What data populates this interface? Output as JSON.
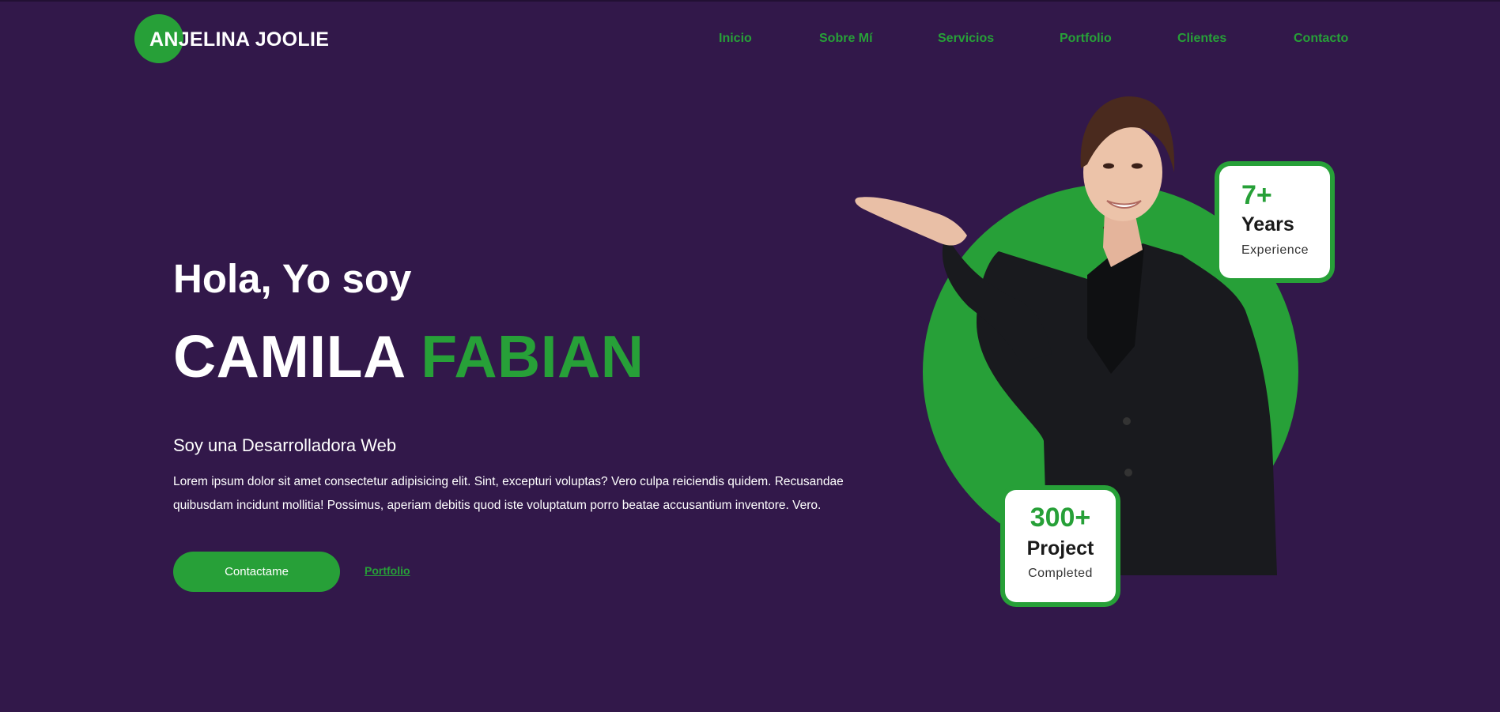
{
  "brand": {
    "logo_text": "ANJELINA JOOLIE"
  },
  "nav": {
    "items": [
      {
        "label": "Inicio"
      },
      {
        "label": "Sobre Mí"
      },
      {
        "label": "Servicios"
      },
      {
        "label": "Portfolio"
      },
      {
        "label": "Clientes"
      },
      {
        "label": "Contacto"
      }
    ]
  },
  "hero": {
    "greeting": "Hola, Yo soy",
    "first_name": "CAMILA",
    "last_name": "FABIAN",
    "role": "Soy una Desarrolladora Web",
    "description": "Lorem ipsum dolor sit amet consectetur adipisicing elit. Sint, excepturi voluptas? Vero culpa reiciendis quidem. Recusandae quibusdam incidunt mollitia! Possimus, aperiam debitis quod iste voluptatum porro beatae accusantium inventore. Vero.",
    "contact_button": "Contactame",
    "portfolio_link": "Portfolio"
  },
  "stats": {
    "years": {
      "number": "7+",
      "label": "Years",
      "sub": "Experience"
    },
    "projects": {
      "number": "300+",
      "label": "Project",
      "sub": "Completed"
    }
  },
  "colors": {
    "background": "#32184a",
    "accent": "#27a038",
    "text": "#ffffff"
  },
  "icons": {
    "portrait": "person-illustration"
  }
}
